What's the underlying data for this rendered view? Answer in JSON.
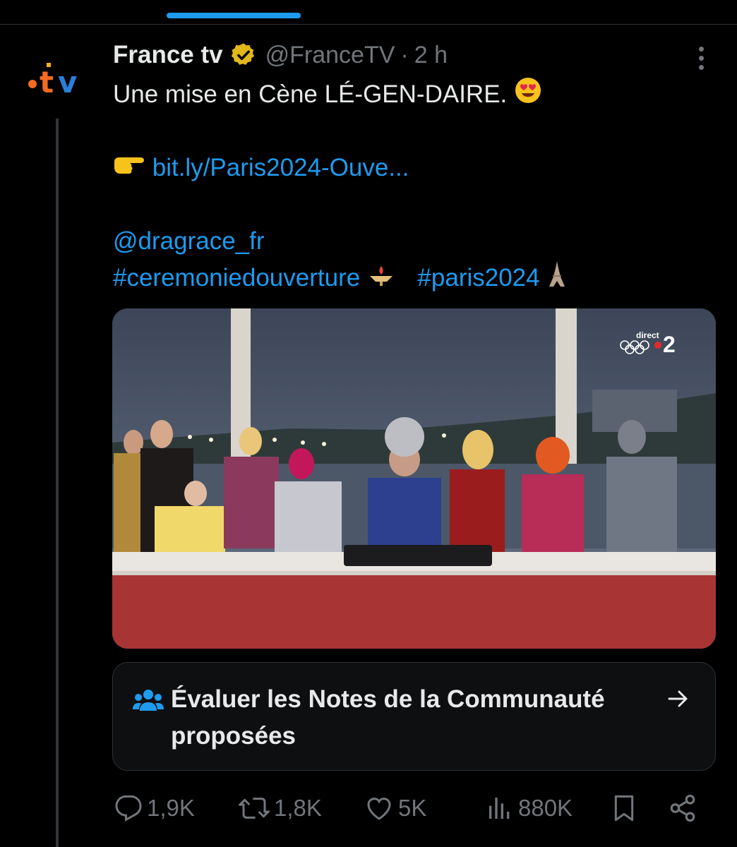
{
  "tweet": {
    "author_name": "France tv",
    "handle": "@FranceTV",
    "separator": "·",
    "time": "2 h",
    "text_line1": "Une mise en Cène LÉ-GEN-DAIRE.",
    "link": "bit.ly/Paris2024-Ouve...",
    "mention": "@dragrace_fr",
    "hashtag1": "#ceremoniedouverture",
    "hashtag2": "#paris2024"
  },
  "avatar": {
    "text": "tv"
  },
  "media": {
    "channel_label": "direct",
    "channel_number": "2"
  },
  "community_notes": {
    "label": "Évaluer les Notes de la Communauté proposées"
  },
  "actions": {
    "replies": "1,9K",
    "reposts": "1,8K",
    "likes": "5K",
    "views": "880K"
  },
  "icons": {
    "verified": "verified-badge-icon",
    "more": "more-icon",
    "heart_eyes": "heart-eyes-emoji-icon",
    "pointing": "pointing-right-emoji-icon",
    "torch": "torch-emoji-icon",
    "eiffel": "eiffel-tower-emoji-icon",
    "people": "people-icon",
    "arrow": "arrow-right-icon",
    "reply": "reply-icon",
    "repost": "repost-icon",
    "like": "heart-icon",
    "views": "views-icon",
    "bookmark": "bookmark-icon",
    "share": "share-icon"
  },
  "colors": {
    "accent": "#1d9bf0",
    "verified_gold": "#e2b719",
    "muted": "#71767b",
    "brand_orange": "#f26b21",
    "brand_blue": "#2b7fd9"
  }
}
